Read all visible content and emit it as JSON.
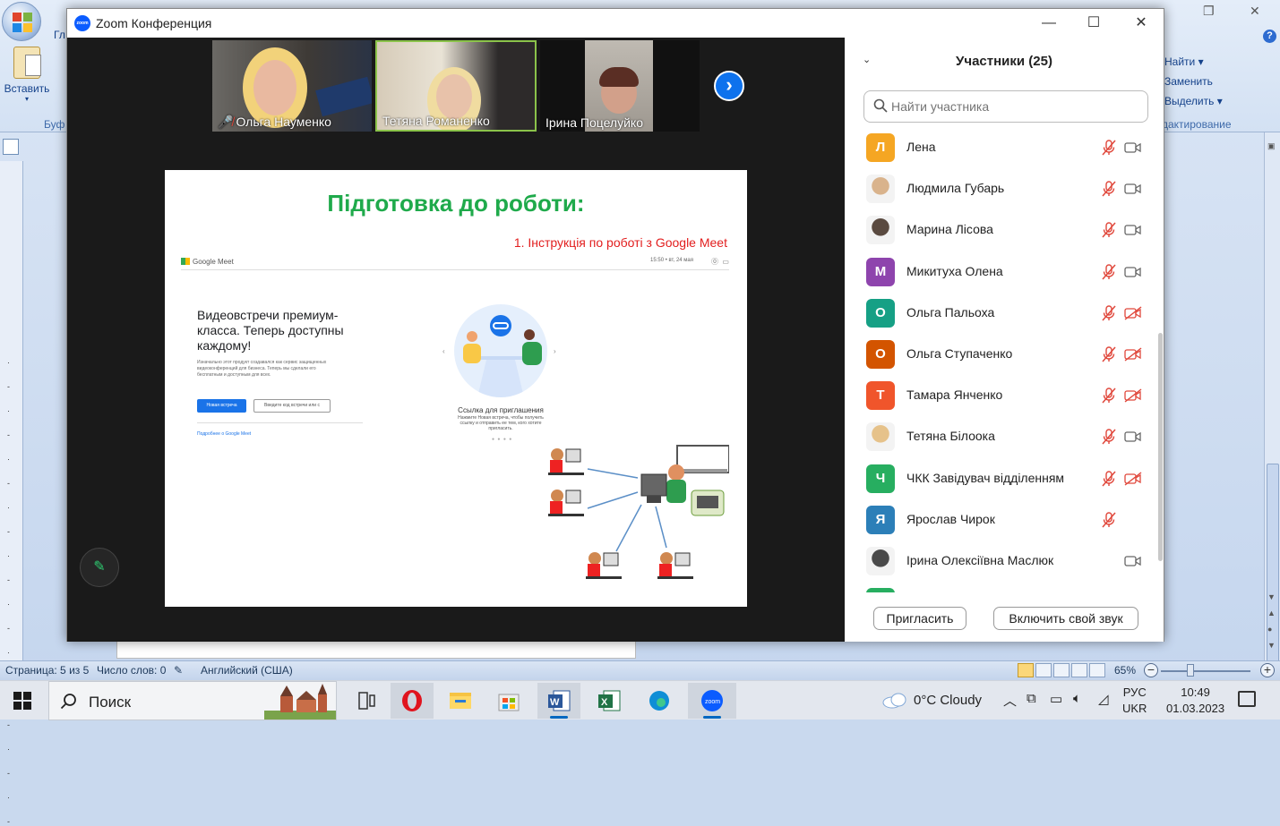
{
  "word": {
    "tab_partial": "Гл",
    "paste_label": "Вставить",
    "clipboard_group_partial": "Буф",
    "find_label": "Найти",
    "replace_label": "Заменить",
    "select_label": "Выделить",
    "editing_group_partial": "дактирование",
    "status": {
      "page": "Страница: 5 из 5",
      "words": "Число слов: 0",
      "language": "Английский (США)",
      "zoom": "65%"
    }
  },
  "zoom": {
    "window_title": "Zoom Конференция",
    "logo_text": "zoom",
    "video_tiles": [
      {
        "name": "Ольга Науменко",
        "muted": true
      },
      {
        "name": "Тетяна Романенко",
        "muted": false
      },
      {
        "name": "Ірина Поцелуйко",
        "muted": false
      }
    ],
    "slide": {
      "title": "Підготовка до роботи:",
      "subtitle": "1. Інструкція по роботі з Google Meet",
      "gm_logo": "Google Meet",
      "gm_time": "15:50 • вт, 24 мая",
      "gm_headline": "Видеовстречи премиум-класса. Теперь доступны каждому!",
      "gm_desc": "Изначально этот продукт создавался как сервис защищенных видеоконференций для бизнеса. Теперь мы сделали его бесплатным и доступным для всех.",
      "gm_new_meeting": "Новая встреча",
      "gm_code_placeholder": "Введите код встречи или с",
      "gm_more": "Подробнее о Google Meet",
      "gm_link_caption": "Ссылка для приглашения",
      "gm_link_desc": "Нажмите Новая встреча, чтобы получить ссылку и отправить ее тем, кого хотите пригласить."
    },
    "participants": {
      "title": "Участники (25)",
      "search_placeholder": "Найти участника",
      "list": [
        {
          "initial": "Л",
          "name": "Лена",
          "color": "#f5a623",
          "photo": false,
          "mic": "off",
          "cam": "on"
        },
        {
          "initial": "",
          "name": "Людмила Губарь",
          "color": "#d9b38c",
          "photo": true,
          "mic": "off",
          "cam": "on"
        },
        {
          "initial": "",
          "name": "Марина Лісова",
          "color": "#5a4a40",
          "photo": true,
          "mic": "off",
          "cam": "on"
        },
        {
          "initial": "М",
          "name": "Микитуха Олена",
          "color": "#8e44ad",
          "photo": false,
          "mic": "off",
          "cam": "on"
        },
        {
          "initial": "О",
          "name": "Ольга Пальоха",
          "color": "#16a085",
          "photo": false,
          "mic": "off",
          "cam": "off"
        },
        {
          "initial": "О",
          "name": "Ольга Ступаченко",
          "color": "#d35400",
          "photo": false,
          "mic": "off",
          "cam": "off"
        },
        {
          "initial": "Т",
          "name": "Тамара Янченко",
          "color": "#f0552b",
          "photo": false,
          "mic": "off",
          "cam": "off"
        },
        {
          "initial": "",
          "name": "Тетяна Білоока",
          "color": "#e6c28a",
          "photo": true,
          "mic": "off",
          "cam": "on"
        },
        {
          "initial": "Ч",
          "name": "ЧКК Завідувач відділенням",
          "color": "#27ae60",
          "photo": false,
          "mic": "off",
          "cam": "off"
        },
        {
          "initial": "Я",
          "name": "Ярослав Чирок",
          "color": "#2c7fb8",
          "photo": false,
          "mic": "off",
          "cam": "none"
        },
        {
          "initial": "",
          "name": "Ірина Олексіївна Маслюк",
          "color": "#4a4a4a",
          "photo": true,
          "mic": "none",
          "cam": "on"
        }
      ],
      "invite_button": "Пригласить",
      "unmute_button": "Включить свой звук"
    }
  },
  "taskbar": {
    "search_label": "Поиск",
    "weather": "0°C  Cloudy",
    "lang_line1": "РУС",
    "lang_line2": "UKR",
    "time": "10:49",
    "date": "01.03.2023"
  }
}
